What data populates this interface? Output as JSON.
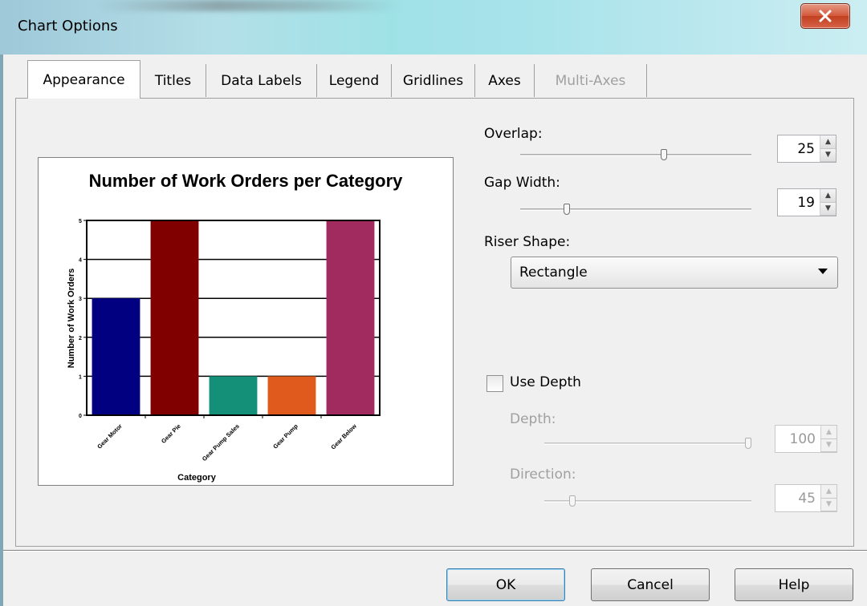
{
  "window": {
    "title": "Chart Options"
  },
  "tabs": [
    {
      "label": "Appearance",
      "active": true,
      "disabled": false
    },
    {
      "label": "Titles",
      "active": false,
      "disabled": false
    },
    {
      "label": "Data Labels",
      "active": false,
      "disabled": false
    },
    {
      "label": "Legend",
      "active": false,
      "disabled": false
    },
    {
      "label": "Gridlines",
      "active": false,
      "disabled": false
    },
    {
      "label": "Axes",
      "active": false,
      "disabled": false
    },
    {
      "label": "Multi-Axes",
      "active": false,
      "disabled": true
    }
  ],
  "controls": {
    "overlap": {
      "label": "Overlap:",
      "value": "25",
      "slider_level": 0.62
    },
    "gap_width": {
      "label": "Gap Width:",
      "value": "19",
      "slider_level": 0.2
    },
    "riser_shape": {
      "label": "Riser Shape:",
      "value": "Rectangle"
    },
    "use_depth": {
      "label": "Use Depth",
      "checked": false
    },
    "depth": {
      "label": "Depth:",
      "value": "100",
      "slider_level": 1.0,
      "disabled": true
    },
    "direction": {
      "label": "Direction:",
      "value": "45",
      "slider_level": 0.12,
      "disabled": true
    }
  },
  "buttons": {
    "ok": "OK",
    "cancel": "Cancel",
    "help": "Help"
  },
  "icons": {
    "close": "close-x-icon",
    "dropdown": "chevron-down-icon",
    "spin_up": "spin-up-icon",
    "spin_down": "spin-down-icon"
  },
  "colors": {
    "bar_navy": "#000080",
    "bar_maroon": "#800000",
    "bar_teal": "#159078",
    "bar_orange": "#e05a1e",
    "bar_plum": "#a12a5e"
  },
  "chart_data": {
    "type": "bar",
    "title": "Number of Work Orders per Category",
    "xlabel": "Category",
    "ylabel": "Number of Work Orders",
    "categories": [
      "Gear Motor",
      "Gear Pie",
      "Gear Pump Sales",
      "Gear Pump",
      "Gear Below"
    ],
    "values": [
      3,
      5,
      1,
      1,
      5
    ],
    "bar_colors": [
      "#000080",
      "#800000",
      "#159078",
      "#e05a1e",
      "#a12a5e"
    ],
    "yticks": [
      "0",
      "1",
      "2",
      "3",
      "4",
      "5"
    ],
    "ylim": [
      0,
      5
    ],
    "grid": true
  }
}
